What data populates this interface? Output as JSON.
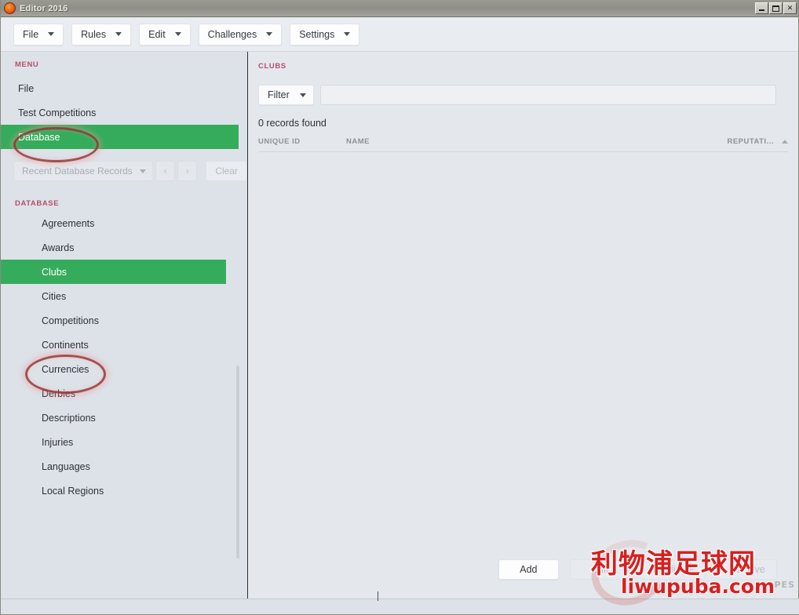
{
  "window": {
    "title": "Editor 2016",
    "app_icon": "editor-app-icon",
    "controls": {
      "minimize": "minimize-icon",
      "maximize": "maximize-icon",
      "close": "✕"
    }
  },
  "menubar": {
    "items": [
      {
        "label": "File",
        "icon": "chevron-down-icon"
      },
      {
        "label": "Rules",
        "icon": "chevron-down-icon"
      },
      {
        "label": "Edit",
        "icon": "chevron-down-icon"
      },
      {
        "label": "Challenges",
        "icon": "chevron-down-icon"
      },
      {
        "label": "Settings",
        "icon": "chevron-down-icon"
      }
    ]
  },
  "sidebar": {
    "menu_section_label": "MENU",
    "menu_items": [
      {
        "label": "File",
        "selected": false
      },
      {
        "label": "Test Competitions",
        "selected": false
      },
      {
        "label": "Database",
        "selected": true
      }
    ],
    "recent": {
      "select_value": "Recent Database Records",
      "select_icon": "chevron-down-icon",
      "prev_icon": "‹",
      "next_icon": "›",
      "clear_label": "Clear"
    },
    "database_section_label": "DATABASE",
    "database_items": [
      {
        "label": "Agreements",
        "selected": false
      },
      {
        "label": "Awards",
        "selected": false
      },
      {
        "label": "Clubs",
        "selected": true
      },
      {
        "label": "Cities",
        "selected": false
      },
      {
        "label": "Competitions",
        "selected": false
      },
      {
        "label": "Continents",
        "selected": false
      },
      {
        "label": "Currencies",
        "selected": false
      },
      {
        "label": "Derbies",
        "selected": false
      },
      {
        "label": "Descriptions",
        "selected": false
      },
      {
        "label": "Injuries",
        "selected": false
      },
      {
        "label": "Languages",
        "selected": false
      },
      {
        "label": "Local Regions",
        "selected": false
      }
    ]
  },
  "main": {
    "section_label": "CLUBS",
    "filter": {
      "button_label": "Filter",
      "button_icon": "chevron-down-icon",
      "input_value": "",
      "input_placeholder": ""
    },
    "records_found": "0 records found",
    "table": {
      "columns": [
        {
          "label": "UNIQUE ID",
          "sorted": false
        },
        {
          "label": "NAME",
          "sorted": false
        },
        {
          "label": "REPUTATI...",
          "sorted": true,
          "sort_icon": "sort-ascending-icon"
        }
      ],
      "rows": []
    },
    "actions": [
      {
        "label": "Add",
        "enabled": true
      },
      {
        "label": "Edit",
        "enabled": false
      },
      {
        "label": "Duplicate",
        "enabled": false
      },
      {
        "label": "Remove",
        "enabled": false
      }
    ]
  },
  "annotations": [
    {
      "name": "annotation-database",
      "shape": "ellipse",
      "target": "Database"
    },
    {
      "name": "annotation-clubs",
      "shape": "ellipse",
      "target": "Clubs"
    }
  ],
  "watermark": {
    "chinese": "利物浦足球网",
    "url": "liwupuba.com",
    "mark": "PES"
  },
  "colors": {
    "selection_green": "#35ac5c",
    "section_label_pink": "#b4506b",
    "annotation_red": "#963737",
    "watermark_red": "#d91f1f"
  }
}
